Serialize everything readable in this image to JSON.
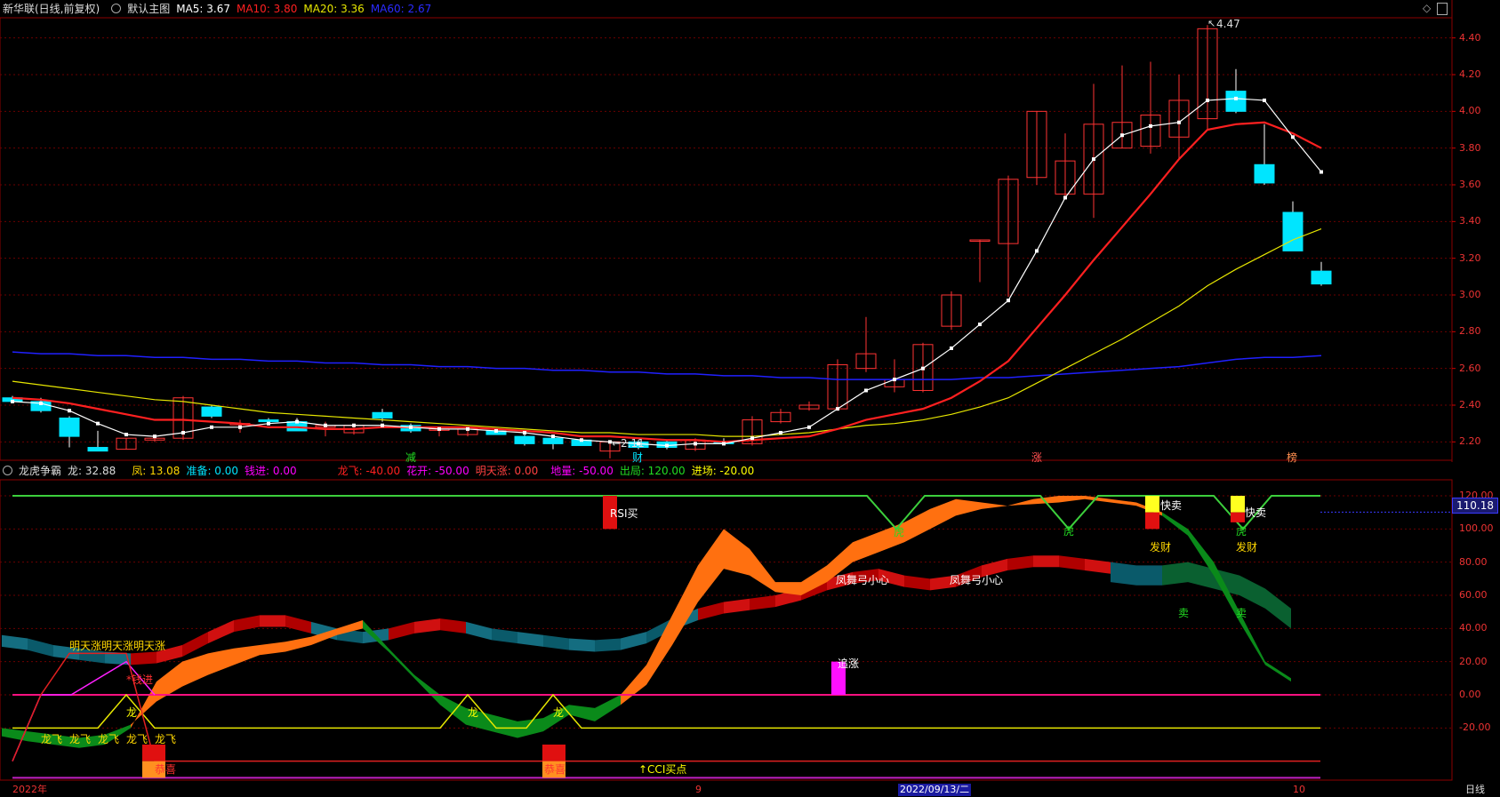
{
  "price_header": {
    "stock": "新华联(日线,前复权)",
    "main": "默认主图",
    "ma5": "MA5: 3.67",
    "ma10": "MA10: 3.80",
    "ma20": "MA20: 3.36",
    "ma60": "MA60: 2.67"
  },
  "ind_header": {
    "name": "龙虎争霸",
    "long": "龙: 32.88",
    "feng": "凤: 13.08",
    "zhunbei": "准备: 0.00",
    "qianjin": "钱进: 0.00",
    "longfei": "龙飞: -40.00",
    "huakai": "花开: -50.00",
    "mingtianzhang": "明天涨: 0.00",
    "diliang": "地量: -50.00",
    "chuju": "出局: 120.00",
    "jinchang": "进场: -20.00"
  },
  "price_axis": [
    "4.40",
    "4.20",
    "4.00",
    "3.80",
    "3.60",
    "3.40",
    "3.20",
    "3.00",
    "2.80",
    "2.60",
    "2.40",
    "2.20"
  ],
  "ind_axis": [
    "120.00",
    "100.00",
    "80.00",
    "60.00",
    "40.00",
    "20.00",
    "0.00",
    "-20.00"
  ],
  "current_value": "110.18",
  "labels": {
    "high": "4.47",
    "low": "←2.11",
    "jian": "减",
    "cai": "财",
    "zhang": "涨",
    "tou": "榜",
    "rsi": "RSI买",
    "zhuizhang": "追涨",
    "cci": "↑CCI买点",
    "mtz": "明天涨明天涨明天涨",
    "qianjin_tag": "*钱进",
    "long1": "龙",
    "long2": "龙",
    "long3": "龙",
    "longfei": "龙飞",
    "gongxi": "恭喜",
    "fengwu1": "凤舞弓小心",
    "fengwu2": "凤舞弓小心",
    "hu1": "虎",
    "hu2": "虎",
    "hu3": "虎",
    "kuaimai1": "快卖",
    "kuaimai2": "快卖",
    "fa1": "发财",
    "fa2": "发财",
    "mai1": "卖",
    "mai2": "卖"
  },
  "bottom_bar": {
    "date_start": "2022年",
    "date_mid": "9",
    "date_sel": "2022/09/13/二",
    "date_end": "10",
    "period": "日线"
  },
  "colors": {
    "ma5": "#ffffff",
    "ma10": "#ff2020",
    "ma20": "#e6e600",
    "ma60": "#2020ff",
    "up": "#ff3333",
    "down": "#00e5ff"
  },
  "chart_data": {
    "type": "candlestick",
    "candles": [
      {
        "o": 2.44,
        "h": 2.45,
        "l": 2.41,
        "c": 2.42
      },
      {
        "o": 2.42,
        "h": 2.44,
        "l": 2.36,
        "c": 2.37
      },
      {
        "o": 2.33,
        "h": 2.34,
        "l": 2.17,
        "c": 2.23
      },
      {
        "o": 2.17,
        "h": 2.26,
        "l": 2.15,
        "c": 2.15
      },
      {
        "o": 2.16,
        "h": 2.22,
        "l": 2.16,
        "c": 2.22
      },
      {
        "o": 2.21,
        "h": 2.24,
        "l": 2.2,
        "c": 2.22
      },
      {
        "o": 2.22,
        "h": 2.45,
        "l": 2.21,
        "c": 2.44
      },
      {
        "o": 2.39,
        "h": 2.4,
        "l": 2.33,
        "c": 2.34
      },
      {
        "o": 2.3,
        "h": 2.32,
        "l": 2.25,
        "c": 2.3
      },
      {
        "o": 2.32,
        "h": 2.33,
        "l": 2.29,
        "c": 2.31
      },
      {
        "o": 2.31,
        "h": 2.33,
        "l": 2.26,
        "c": 2.26
      },
      {
        "o": 2.28,
        "h": 2.31,
        "l": 2.23,
        "c": 2.29
      },
      {
        "o": 2.25,
        "h": 2.3,
        "l": 2.24,
        "c": 2.29
      },
      {
        "o": 2.36,
        "h": 2.38,
        "l": 2.31,
        "c": 2.33
      },
      {
        "o": 2.29,
        "h": 2.3,
        "l": 2.25,
        "c": 2.26
      },
      {
        "o": 2.27,
        "h": 2.28,
        "l": 2.23,
        "c": 2.27
      },
      {
        "o": 2.24,
        "h": 2.27,
        "l": 2.23,
        "c": 2.27
      },
      {
        "o": 2.26,
        "h": 2.27,
        "l": 2.24,
        "c": 2.24
      },
      {
        "o": 2.23,
        "h": 2.24,
        "l": 2.18,
        "c": 2.19
      },
      {
        "o": 2.22,
        "h": 2.22,
        "l": 2.16,
        "c": 2.19
      },
      {
        "o": 2.21,
        "h": 2.22,
        "l": 2.18,
        "c": 2.18
      },
      {
        "o": 2.15,
        "h": 2.2,
        "l": 2.11,
        "c": 2.2
      },
      {
        "o": 2.2,
        "h": 2.21,
        "l": 2.16,
        "c": 2.17
      },
      {
        "o": 2.2,
        "h": 2.21,
        "l": 2.16,
        "c": 2.17
      },
      {
        "o": 2.16,
        "h": 2.22,
        "l": 2.15,
        "c": 2.21
      },
      {
        "o": 2.2,
        "h": 2.22,
        "l": 2.19,
        "c": 2.19
      },
      {
        "o": 2.19,
        "h": 2.34,
        "l": 2.18,
        "c": 2.32
      },
      {
        "o": 2.31,
        "h": 2.38,
        "l": 2.3,
        "c": 2.36
      },
      {
        "o": 2.38,
        "h": 2.42,
        "l": 2.37,
        "c": 2.4
      },
      {
        "o": 2.38,
        "h": 2.65,
        "l": 2.37,
        "c": 2.62
      },
      {
        "o": 2.6,
        "h": 2.88,
        "l": 2.58,
        "c": 2.68
      },
      {
        "o": 2.5,
        "h": 2.65,
        "l": 2.47,
        "c": 2.54
      },
      {
        "o": 2.48,
        "h": 2.74,
        "l": 2.47,
        "c": 2.73
      },
      {
        "o": 2.83,
        "h": 3.02,
        "l": 2.81,
        "c": 3.0
      },
      {
        "o": 3.3,
        "h": 3.3,
        "l": 3.07,
        "c": 3.3
      },
      {
        "o": 3.28,
        "h": 3.65,
        "l": 2.99,
        "c": 3.63
      },
      {
        "o": 3.64,
        "h": 4.0,
        "l": 3.6,
        "c": 4.0
      },
      {
        "o": 3.55,
        "h": 3.88,
        "l": 3.52,
        "c": 3.73
      },
      {
        "o": 3.55,
        "h": 4.15,
        "l": 3.42,
        "c": 3.93
      },
      {
        "o": 3.8,
        "h": 4.25,
        "l": 3.8,
        "c": 3.94
      },
      {
        "o": 3.81,
        "h": 4.27,
        "l": 3.77,
        "c": 3.98
      },
      {
        "o": 3.86,
        "h": 4.2,
        "l": 3.74,
        "c": 4.06
      },
      {
        "o": 3.96,
        "h": 4.47,
        "l": 3.9,
        "c": 4.45
      },
      {
        "o": 4.11,
        "h": 4.23,
        "l": 3.99,
        "c": 4.0
      },
      {
        "o": 3.71,
        "h": 3.93,
        "l": 3.6,
        "c": 3.61
      },
      {
        "o": 3.45,
        "h": 3.51,
        "l": 3.24,
        "c": 3.24
      },
      {
        "o": 3.13,
        "h": 3.18,
        "l": 3.05,
        "c": 3.06
      }
    ],
    "ma5": [
      2.42,
      2.41,
      2.37,
      2.3,
      2.24,
      2.23,
      2.25,
      2.28,
      2.28,
      2.3,
      2.31,
      2.29,
      2.29,
      2.29,
      2.28,
      2.27,
      2.27,
      2.26,
      2.25,
      2.23,
      2.21,
      2.2,
      2.19,
      2.18,
      2.19,
      2.19,
      2.22,
      2.25,
      2.28,
      2.38,
      2.48,
      2.54,
      2.6,
      2.71,
      2.84,
      2.97,
      3.24,
      3.53,
      3.74,
      3.87,
      3.92,
      3.94,
      4.06,
      4.07,
      4.06,
      3.86,
      3.67
    ],
    "ma10": [
      2.44,
      2.43,
      2.41,
      2.38,
      2.35,
      2.32,
      2.32,
      2.31,
      2.3,
      2.28,
      2.28,
      2.27,
      2.27,
      2.28,
      2.28,
      2.28,
      2.28,
      2.27,
      2.26,
      2.25,
      2.23,
      2.23,
      2.22,
      2.21,
      2.21,
      2.2,
      2.21,
      2.22,
      2.23,
      2.27,
      2.32,
      2.35,
      2.38,
      2.44,
      2.53,
      2.64,
      2.82,
      3.0,
      3.19,
      3.37,
      3.55,
      3.74,
      3.9,
      3.93,
      3.94,
      3.88,
      3.8
    ],
    "ma20": [
      2.53,
      2.51,
      2.49,
      2.47,
      2.45,
      2.43,
      2.42,
      2.4,
      2.38,
      2.36,
      2.35,
      2.34,
      2.33,
      2.32,
      2.31,
      2.3,
      2.29,
      2.28,
      2.27,
      2.26,
      2.25,
      2.25,
      2.24,
      2.24,
      2.24,
      2.23,
      2.23,
      2.24,
      2.25,
      2.27,
      2.29,
      2.3,
      2.32,
      2.35,
      2.39,
      2.44,
      2.52,
      2.6,
      2.68,
      2.76,
      2.85,
      2.94,
      3.05,
      3.14,
      3.22,
      3.3,
      3.36
    ],
    "ma60": [
      2.69,
      2.68,
      2.68,
      2.67,
      2.67,
      2.66,
      2.66,
      2.65,
      2.65,
      2.64,
      2.64,
      2.63,
      2.63,
      2.62,
      2.62,
      2.61,
      2.61,
      2.6,
      2.6,
      2.59,
      2.59,
      2.58,
      2.58,
      2.57,
      2.57,
      2.56,
      2.56,
      2.55,
      2.55,
      2.54,
      2.54,
      2.54,
      2.54,
      2.54,
      2.55,
      2.55,
      2.56,
      2.57,
      2.58,
      2.59,
      2.6,
      2.61,
      2.63,
      2.65,
      2.66,
      2.66,
      2.67
    ],
    "ylim": [
      2.1,
      4.5
    ]
  }
}
